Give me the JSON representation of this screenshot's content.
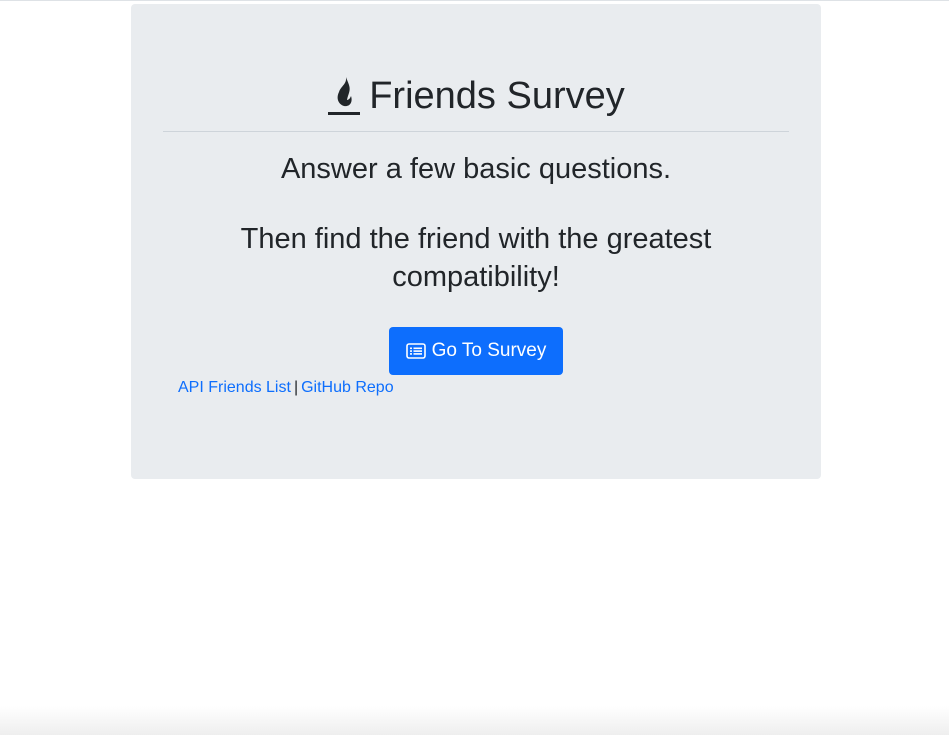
{
  "header": {
    "icon": "fire-icon",
    "title": "Friends Survey"
  },
  "intro": {
    "line1": "Answer a few basic questions.",
    "line2": "Then find the friend with the greatest compatibility!"
  },
  "survey_button": {
    "icon": "list-icon",
    "label": "Go To Survey"
  },
  "links": {
    "api_friends": "API Friends List",
    "separator": "|",
    "github": "GitHub Repo"
  },
  "colors": {
    "jumbotron": "#e9ecef",
    "primary": "#0d6efd",
    "text": "#212529"
  }
}
